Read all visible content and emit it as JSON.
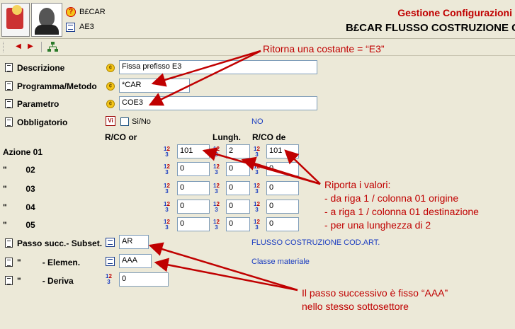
{
  "header": {
    "app_code": "B£CAR",
    "object_code": "AE3",
    "title": "Gestione Configurazioni",
    "subtitle": "B£CAR FLUSSO COSTRUZIONE C"
  },
  "toolbar": {
    "prev_icon": "arrow-left-icon",
    "next_icon": "arrow-right-icon",
    "tree_icon": "tree-icon"
  },
  "form": {
    "descrizione": {
      "label": "Descrizione",
      "value": "Fissa prefisso E3"
    },
    "programma": {
      "label": "Programma/Metodo",
      "value": "*CAR"
    },
    "parametro": {
      "label": "Parametro",
      "value": "COE3"
    },
    "obbligatorio": {
      "label": "Obbligatorio",
      "checkbox_label": "Si/No",
      "value_text": "NO"
    },
    "columns": {
      "rco_or": "R/CO or",
      "lungh": "Lungh.",
      "rco_de": "R/CO de"
    },
    "azioni": [
      {
        "label": "Azione 01",
        "origin": "101",
        "length": "2",
        "dest": "101"
      },
      {
        "label": "\"        02",
        "origin": "0",
        "length": "0",
        "dest": "0"
      },
      {
        "label": "\"        03",
        "origin": "0",
        "length": "0",
        "dest": "0"
      },
      {
        "label": "\"        04",
        "origin": "0",
        "length": "0",
        "dest": "0"
      },
      {
        "label": "\"        05",
        "origin": "0",
        "length": "0",
        "dest": "0"
      }
    ],
    "passo": {
      "label": "Passo succ.- Subset.",
      "value": "AR",
      "description": "FLUSSO COSTRUZIONE COD.ART."
    },
    "elemen": {
      "label": "\"         - Elemen.",
      "value": "AAA",
      "description": "Classe materiale"
    },
    "deriva": {
      "label": "\"         - Deriva",
      "value": "0"
    }
  },
  "annotations": {
    "top": "Ritorna una costante = “E3”",
    "middle": [
      "Riporta i valori:",
      "- da riga 1 / colonna 01 origine",
      "- a riga 1 / colonna 01 destinazione",
      "- per una lunghezza di 2"
    ],
    "bottom": [
      "Il passo successivo è fisso “AAA”",
      "nello stesso sottosettore"
    ]
  },
  "colors": {
    "annotation": "#c00000",
    "link_blue": "#1a3cc0",
    "title_red": "#c00000"
  }
}
